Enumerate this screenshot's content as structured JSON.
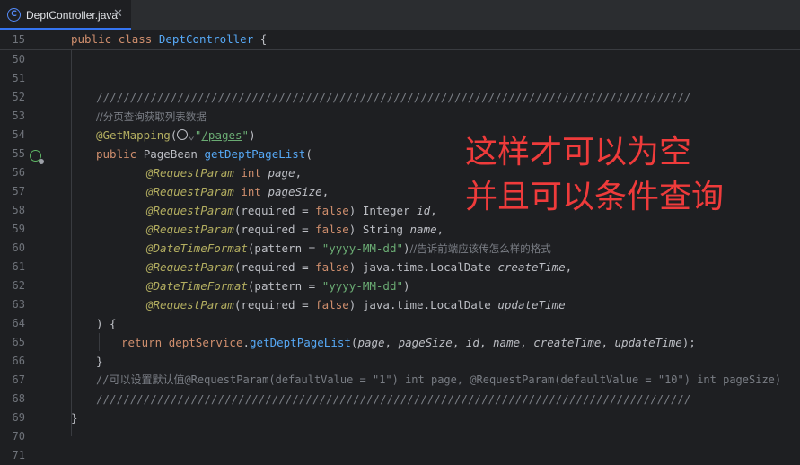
{
  "tab": {
    "label": "DeptController.java",
    "icon": "C",
    "close_glyph": "✕"
  },
  "sticky": {
    "line_number": "15",
    "kw1": "public",
    "kw2": "class",
    "class_name": "DeptController",
    "brace": "{"
  },
  "lines": {
    "l50": {
      "n": "50"
    },
    "l51": {
      "n": "51"
    },
    "l52": {
      "n": "52",
      "text": "////////////////////////////////////////////////////////////////////////////////////////"
    },
    "l53": {
      "n": "53",
      "text": "//分页查询获取列表数据"
    },
    "l54": {
      "n": "54",
      "anno": "@GetMapping",
      "open": "(",
      "dq1": "\"",
      "path": "/pages",
      "dq2": "\"",
      "close": ")"
    },
    "l55": {
      "n": "55",
      "kw": "public",
      "type": "PageBean",
      "method": "getDeptPageList",
      "open": "("
    },
    "l56": {
      "n": "56",
      "anno": "@RequestParam",
      "kw": "int",
      "param": "page",
      "tail": ","
    },
    "l57": {
      "n": "57",
      "anno": "@RequestParam",
      "kw": "int",
      "param": "pageSize",
      "tail": ","
    },
    "l58": {
      "n": "58",
      "anno": "@RequestParam",
      "p1": "(required = ",
      "kw": "false",
      "p2": ") Integer ",
      "param": "id",
      "tail": ","
    },
    "l59": {
      "n": "59",
      "anno": "@RequestParam",
      "p1": "(required = ",
      "kw": "false",
      "p2": ") String ",
      "param": "name",
      "tail": ","
    },
    "l60": {
      "n": "60",
      "anno": "@DateTimeFormat",
      "p1": "(pattern = ",
      "str": "\"yyyy-MM-dd\"",
      "p2": ")",
      "comment": "//告诉前端应该传怎么样的格式"
    },
    "l61": {
      "n": "61",
      "anno": "@RequestParam",
      "p1": "(required = ",
      "kw": "false",
      "p2": ") java.time.LocalDate ",
      "param": "createTime",
      "tail": ","
    },
    "l62": {
      "n": "62",
      "anno": "@DateTimeFormat",
      "p1": "(pattern = ",
      "str": "\"yyyy-MM-dd\"",
      "p2": ")"
    },
    "l63": {
      "n": "63",
      "anno": "@RequestParam",
      "p1": "(required = ",
      "kw": "false",
      "p2": ") java.time.LocalDate ",
      "param": "updateTime"
    },
    "l64": {
      "n": "64",
      "text": ") {"
    },
    "l65": {
      "n": "65",
      "kw": "return",
      "field": "deptService",
      "dot": ".",
      "method": "getDeptPageList",
      "args": "(",
      "a1": "page",
      "c1": ", ",
      "a2": "pageSize",
      "c2": ", ",
      "a3": "id",
      "c3": ", ",
      "a4": "name",
      "c4": ", ",
      "a5": "createTime",
      "c5": ", ",
      "a6": "updateTime",
      "end": ");"
    },
    "l66": {
      "n": "66",
      "text": "}"
    },
    "l67": {
      "n": "67",
      "text": "//可以设置默认值@RequestParam(defaultValue = \"1\") int page, @RequestParam(defaultValue = \"10\") int pageSize)"
    },
    "l68": {
      "n": "68",
      "text": "////////////////////////////////////////////////////////////////////////////////////////"
    },
    "l69": {
      "n": "69",
      "text": "}"
    },
    "l70": {
      "n": "70"
    },
    "l71": {
      "n": "71"
    }
  },
  "overlay": {
    "line1": "这样才可以为空",
    "line2": "并且可以条件查询"
  },
  "colors": {
    "background": "#1e1f22",
    "keyword": "#cf8e6d",
    "function": "#56a8f5",
    "annotation": "#b3ae60",
    "string": "#6aab73",
    "comment": "#7a7e85",
    "overlay_text": "#ef3b3b"
  }
}
